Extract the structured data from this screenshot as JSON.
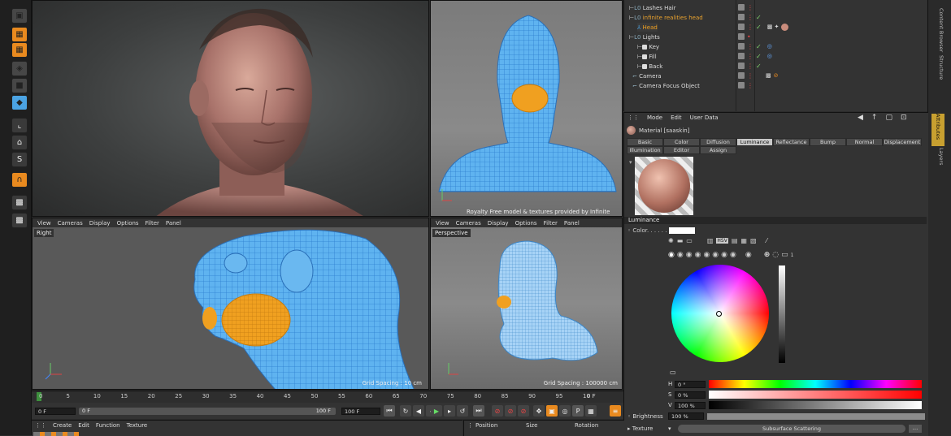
{
  "viewport_top_left": {},
  "viewport_top_right": {
    "credit": "Royalty Free model & textures provided by Infinite Realities"
  },
  "viewport_bottom_left": {
    "menu": [
      "View",
      "Cameras",
      "Display",
      "Options",
      "Filter",
      "Panel"
    ],
    "label": "Right",
    "grid_spacing": "Grid Spacing : 10 cm"
  },
  "viewport_bottom_right": {
    "menu": [
      "View",
      "Cameras",
      "Display",
      "Options",
      "Filter",
      "Panel"
    ],
    "label": "Perspective",
    "grid_spacing": "Grid Spacing : 100000 cm"
  },
  "object_manager": {
    "items": [
      "Lashes Hair",
      "infinite realities head",
      "Head",
      "Lights",
      "Key",
      "Fill",
      "Back",
      "Camera",
      "Camera Focus Object"
    ]
  },
  "side_tabs": [
    "Content Browser",
    "Structure",
    "Attributes",
    "Layers"
  ],
  "attributes": {
    "menu": [
      "Mode",
      "Edit",
      "User Data"
    ],
    "material_name": "Material [saaskin]",
    "tabs_row1": [
      "Basic",
      "Color",
      "Diffusion",
      "Luminance",
      "Reflectance",
      "Bump",
      "Normal",
      "Displacement"
    ],
    "tabs_row2": [
      "Illumination",
      "Editor",
      "Assign"
    ],
    "active_tab": "Luminance",
    "section_title": "Luminance",
    "color_label": "Color. . . . . .",
    "hsv_mode_label": "HSV",
    "counter": "1",
    "h_label": "H",
    "h_value": "0 °",
    "s_label": "S",
    "s_value": "0 %",
    "v_label": "V",
    "v_value": "100 %",
    "brightness_label": "Brightness",
    "brightness_value": "100 %",
    "texture_label": "Texture",
    "texture_button": "Subsurface Scattering",
    "texture_more": "..."
  },
  "timeline": {
    "ticks": [
      "0",
      "5",
      "10",
      "15",
      "20",
      "25",
      "30",
      "35",
      "40",
      "45",
      "50",
      "55",
      "60",
      "65",
      "70",
      "75",
      "80",
      "85",
      "90",
      "95",
      "10"
    ],
    "current_frame": "0 F",
    "start_field": "0 F",
    "range_start": "0 F",
    "range_end": "100 F",
    "end_field": "100 F"
  },
  "material_manager": {
    "menu": [
      "Create",
      "Edit",
      "Function",
      "Texture"
    ]
  },
  "coordinates": {
    "headers": [
      "Position",
      "Size",
      "Rotation"
    ]
  },
  "colors": {
    "orange": "#e98a1f",
    "wire_blue": "#4ba3e3",
    "selection_orange": "#f0a020",
    "active_tab": "#c8c8c8"
  }
}
